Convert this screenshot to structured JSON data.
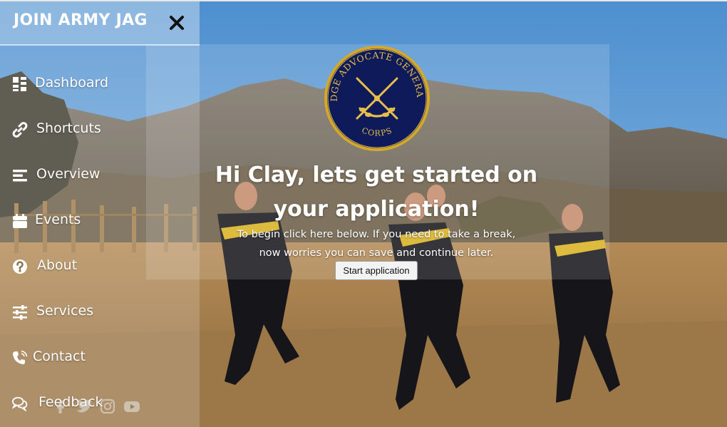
{
  "drawer": {
    "brand": "JOIN ARMY JAG",
    "close_icon": "close-icon",
    "items": [
      {
        "label": "Dashboard",
        "icon": "grid-icon"
      },
      {
        "label": "Shortcuts",
        "icon": "link-icon"
      },
      {
        "label": "Overview",
        "icon": "list-icon"
      },
      {
        "label": "Events",
        "icon": "calendar-icon"
      },
      {
        "label": "About",
        "icon": "question-icon"
      },
      {
        "label": "Services",
        "icon": "sliders-icon"
      },
      {
        "label": "Contact",
        "icon": "phone-icon"
      },
      {
        "label": "Feedback",
        "icon": "comments-icon"
      }
    ],
    "socials": [
      "facebook-icon",
      "twitter-icon",
      "instagram-icon",
      "youtube-icon"
    ]
  },
  "hero": {
    "logo_top_text": "JUDGE ADVOCATE GENERAL'S",
    "logo_bottom_text": "CORPS",
    "title_line1": "Hi Clay, lets get started on",
    "title_line2": "your application!",
    "subtitle_line1": "To begin click here below. If you need to take a break,",
    "subtitle_line2": "now worries you can save and continue later.",
    "start_button": "Start application"
  },
  "colors": {
    "sky": "#4d8fcf",
    "logo_navy": "#0e1a5a",
    "logo_gold": "#d4a82a",
    "text": "#ffffff"
  }
}
